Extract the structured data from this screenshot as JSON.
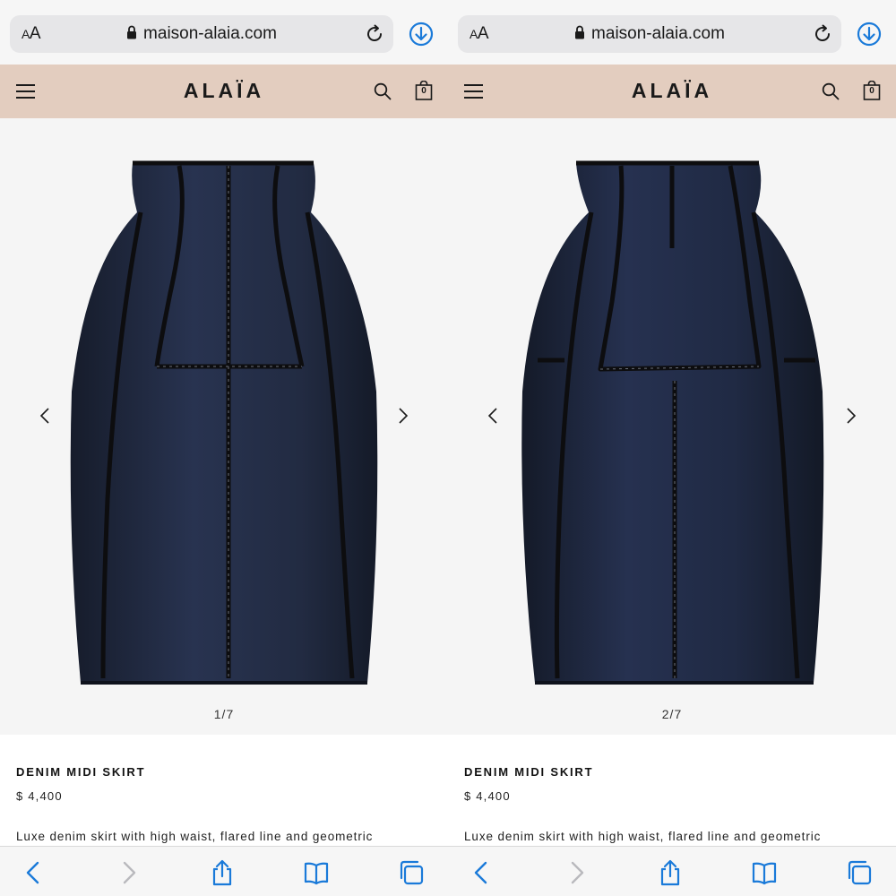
{
  "browser": {
    "text_size_label": "AA",
    "url": "maison-alaia.com",
    "icons": [
      "lock-icon",
      "reload-icon",
      "download-icon"
    ]
  },
  "site": {
    "logo": "ALAÏA",
    "cart_count": "0",
    "icons": [
      "hamburger-menu-icon",
      "search-icon",
      "shopping-bag-icon"
    ],
    "header_color": "#e3cdbf"
  },
  "panes": [
    {
      "gallery": {
        "counter": "1/7",
        "view": "front"
      },
      "product": {
        "name": "DENIM MIDI SKIRT",
        "price": "$ 4,400",
        "description": "Luxe denim skirt with high waist, flared line and geometric"
      }
    },
    {
      "gallery": {
        "counter": "2/7",
        "view": "back"
      },
      "product": {
        "name": "DENIM MIDI SKIRT",
        "price": "$ 4,400",
        "description": "Luxe denim skirt with high waist, flared line and geometric"
      }
    }
  ],
  "toolbar": {
    "icons": [
      "back-icon",
      "forward-icon",
      "share-icon",
      "bookmarks-icon",
      "tabs-icon"
    ],
    "accent_color": "#1a7ad9"
  },
  "colors": {
    "denim": "#1e2638",
    "trim": "#111111",
    "gallery_bg": "#f5f5f5"
  }
}
